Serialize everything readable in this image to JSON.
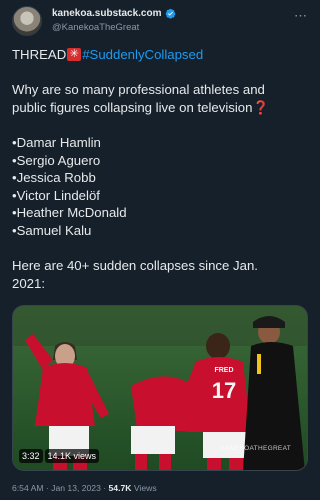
{
  "author": {
    "display_name": "kanekoa.substack.com",
    "handle": "@KanekoaTheGreat",
    "verified_icon": "verified-badge-icon"
  },
  "tweet": {
    "thread_label": "THREAD",
    "hashtag": "#SuddenlyCollapsed",
    "question": "Why are so many professional athletes and",
    "question_line2": "public figures collapsing live on television",
    "question_mark": "❓",
    "names": [
      "•Damar Hamlin",
      "•Sergio Aguero",
      "•Jessica Robb",
      "•Victor Lindelöf",
      "•Heather McDonald",
      "•Samuel Kalu"
    ],
    "closing_line1": "Here are 40+ sudden collapses since Jan.",
    "closing_line2": "2021:"
  },
  "video": {
    "duration": "3:32",
    "views": "14.1K views",
    "watermark": "KANEKOATHEGREAT",
    "jersey_name": "FRED",
    "jersey_number": "17"
  },
  "meta": {
    "time": "6:54 AM",
    "separator": " · ",
    "date": "Jan 13, 2023",
    "views_count": "54.7K",
    "views_label": "Views"
  },
  "colors": {
    "background": "#15202b",
    "link": "#1d9bf0",
    "muted": "#8b98a5"
  }
}
